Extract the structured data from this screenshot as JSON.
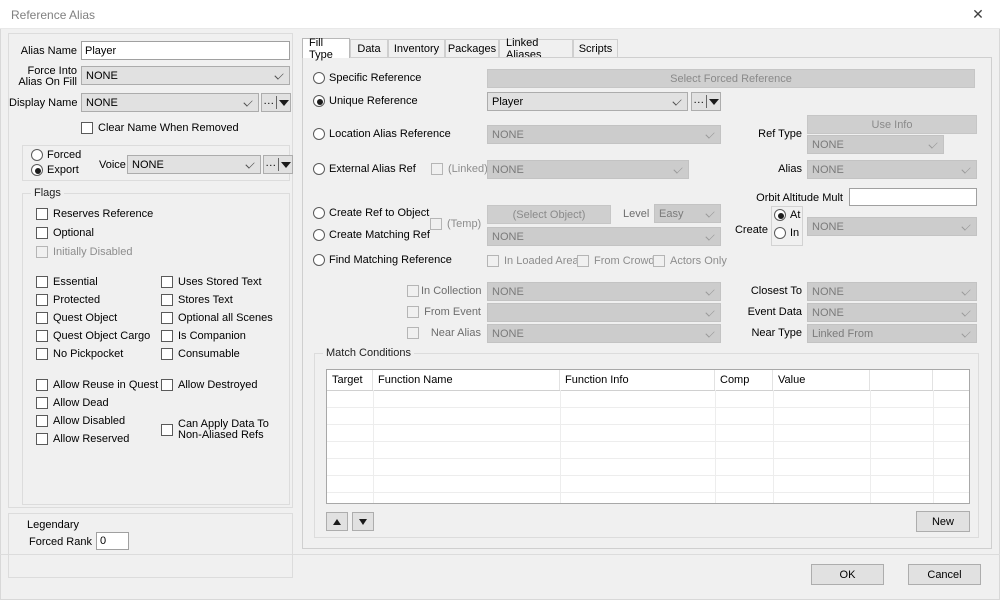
{
  "window": {
    "title": "Reference Alias",
    "close_icon": "close-icon"
  },
  "left_panel": {
    "alias_name": {
      "label": "Alias Name",
      "value": "Player"
    },
    "force_into": {
      "label_line1": "Force Into",
      "label_line2": "Alias On Fill",
      "value": "NONE"
    },
    "display_name": {
      "label": "Display Name",
      "value": "NONE",
      "ellipsis": "..."
    },
    "clear_name": {
      "label": "Clear Name When Removed",
      "checked": false
    },
    "fill_mode": {
      "forced": {
        "label": "Forced",
        "selected": false
      },
      "export": {
        "label": "Export",
        "selected": true
      }
    },
    "voice": {
      "label": "Voice",
      "value": "NONE",
      "ellipsis": "..."
    },
    "flags": {
      "caption": "Flags",
      "top": [
        {
          "label": "Reserves Reference",
          "checked": false,
          "disabled": false
        },
        {
          "label": "Optional",
          "checked": false,
          "disabled": false
        },
        {
          "label": "Initially Disabled",
          "checked": false,
          "disabled": true
        }
      ],
      "col1": [
        {
          "label": "Essential",
          "checked": false
        },
        {
          "label": "Protected",
          "checked": false
        },
        {
          "label": "Quest Object",
          "checked": false
        },
        {
          "label": "Quest Object Cargo",
          "checked": false
        },
        {
          "label": "No Pickpocket",
          "checked": false
        }
      ],
      "col2": [
        {
          "label": "Uses Stored Text",
          "checked": false
        },
        {
          "label": "Stores Text",
          "checked": false
        },
        {
          "label": "Optional all Scenes",
          "checked": false
        },
        {
          "label": "Is Companion",
          "checked": false
        },
        {
          "label": "Consumable",
          "checked": false
        }
      ],
      "col3": [
        {
          "label": "Allow Reuse in Quest",
          "checked": false
        },
        {
          "label": "Allow Dead",
          "checked": false
        },
        {
          "label": "Allow Disabled",
          "checked": false
        },
        {
          "label": "Allow Reserved",
          "checked": false
        }
      ],
      "col4": [
        {
          "label": "Allow Destroyed",
          "checked": false
        }
      ],
      "col4_wrap": {
        "line1": "Can Apply Data To",
        "line2": "Non-Aliased Refs",
        "checked": false
      }
    },
    "legendary": {
      "caption": "Legendary",
      "forced_rank": {
        "label": "Forced Rank",
        "value": "0"
      }
    }
  },
  "tabs": [
    {
      "label": "Fill Type",
      "selected": true
    },
    {
      "label": "Data",
      "selected": false
    },
    {
      "label": "Inventory",
      "selected": false
    },
    {
      "label": "Packages",
      "selected": false
    },
    {
      "label": "Linked Aliases",
      "selected": false
    },
    {
      "label": "Scripts",
      "selected": false
    }
  ],
  "fill_type": {
    "specific_reference": {
      "label": "Specific Reference",
      "selected": false
    },
    "forced_ref_button": {
      "label": "Select Forced Reference",
      "disabled": true
    },
    "unique_reference": {
      "label": "Unique Reference",
      "selected": true
    },
    "unique_value": "Player",
    "unique_ellipsis": "...",
    "location_alias_reference": {
      "label": "Location Alias Reference",
      "selected": false
    },
    "location_value": "NONE",
    "external_alias_ref": {
      "label": "External Alias Ref",
      "selected": false
    },
    "linked": {
      "label": "(Linked)",
      "checked": false
    },
    "external_value": "NONE",
    "use_info_button": {
      "label": "Use Info",
      "disabled": true
    },
    "ref_type": {
      "label": "Ref Type",
      "value": "NONE"
    },
    "alias": {
      "label": "Alias",
      "value": "NONE"
    },
    "orbit_altitude_mult": {
      "label": "Orbit Altitude Mult",
      "value": ""
    },
    "create_ref_to_object": {
      "label": "Create Ref to Object",
      "selected": false
    },
    "temp": {
      "label": "(Temp)",
      "checked": false
    },
    "select_object_button": {
      "label": "(Select Object)",
      "disabled": true
    },
    "level": {
      "label": "Level",
      "value": "Easy"
    },
    "create_matching_ref": {
      "label": "Create Matching Ref",
      "selected": false
    },
    "matching_value": "NONE",
    "create": {
      "label": "Create",
      "at": {
        "label": "At",
        "selected": true
      },
      "in": {
        "label": "In",
        "selected": false
      },
      "value": "NONE"
    },
    "find_matching_reference": {
      "label": "Find Matching Reference",
      "selected": false
    },
    "in_loaded_area": {
      "label": "In Loaded Area",
      "checked": false
    },
    "from_crowd": {
      "label": "From Crowd",
      "checked": false
    },
    "actors_only": {
      "label": "Actors Only",
      "checked": false
    },
    "in_collection": {
      "label": "In Collection",
      "checked": false,
      "value": "NONE"
    },
    "from_event": {
      "label": "From Event",
      "checked": false,
      "value": ""
    },
    "near_alias": {
      "label": "Near Alias",
      "checked": false,
      "value": "NONE"
    },
    "closest_to": {
      "label": "Closest To",
      "value": "NONE"
    },
    "event_data": {
      "label": "Event Data",
      "value": "NONE"
    },
    "near_type": {
      "label": "Near Type",
      "value": "Linked From"
    }
  },
  "match_conditions": {
    "caption": "Match Conditions",
    "columns": [
      "Target",
      "Function Name",
      "Function Info",
      "Comp",
      "Value",
      "",
      ""
    ],
    "rows": [],
    "move_up_icon": "triangle-up-icon",
    "move_down_icon": "triangle-down-icon",
    "new_button": "New"
  },
  "footer": {
    "ok": "OK",
    "cancel": "Cancel"
  }
}
